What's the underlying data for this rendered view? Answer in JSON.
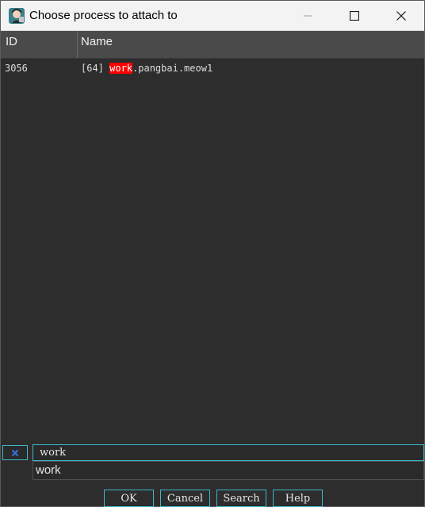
{
  "window": {
    "title": "Choose process to attach to",
    "app_icon": "cheat-engine-icon"
  },
  "columns": {
    "id": "ID",
    "name": "Name"
  },
  "processes": [
    {
      "id": "3056",
      "prefix": "[64] ",
      "match": "work",
      "suffix": ".pangbai.meow1"
    }
  ],
  "filter": {
    "value": "work",
    "clear_icon": "clear-x-icon",
    "suggestion": "work"
  },
  "buttons": {
    "ok": "OK",
    "cancel": "Cancel",
    "search": "Search",
    "help": "Help"
  },
  "colors": {
    "highlight": "#ff0000",
    "accent_border": "#3cb8c8",
    "header_bg": "#4a4a4a",
    "list_bg": "#2d2d2d"
  }
}
